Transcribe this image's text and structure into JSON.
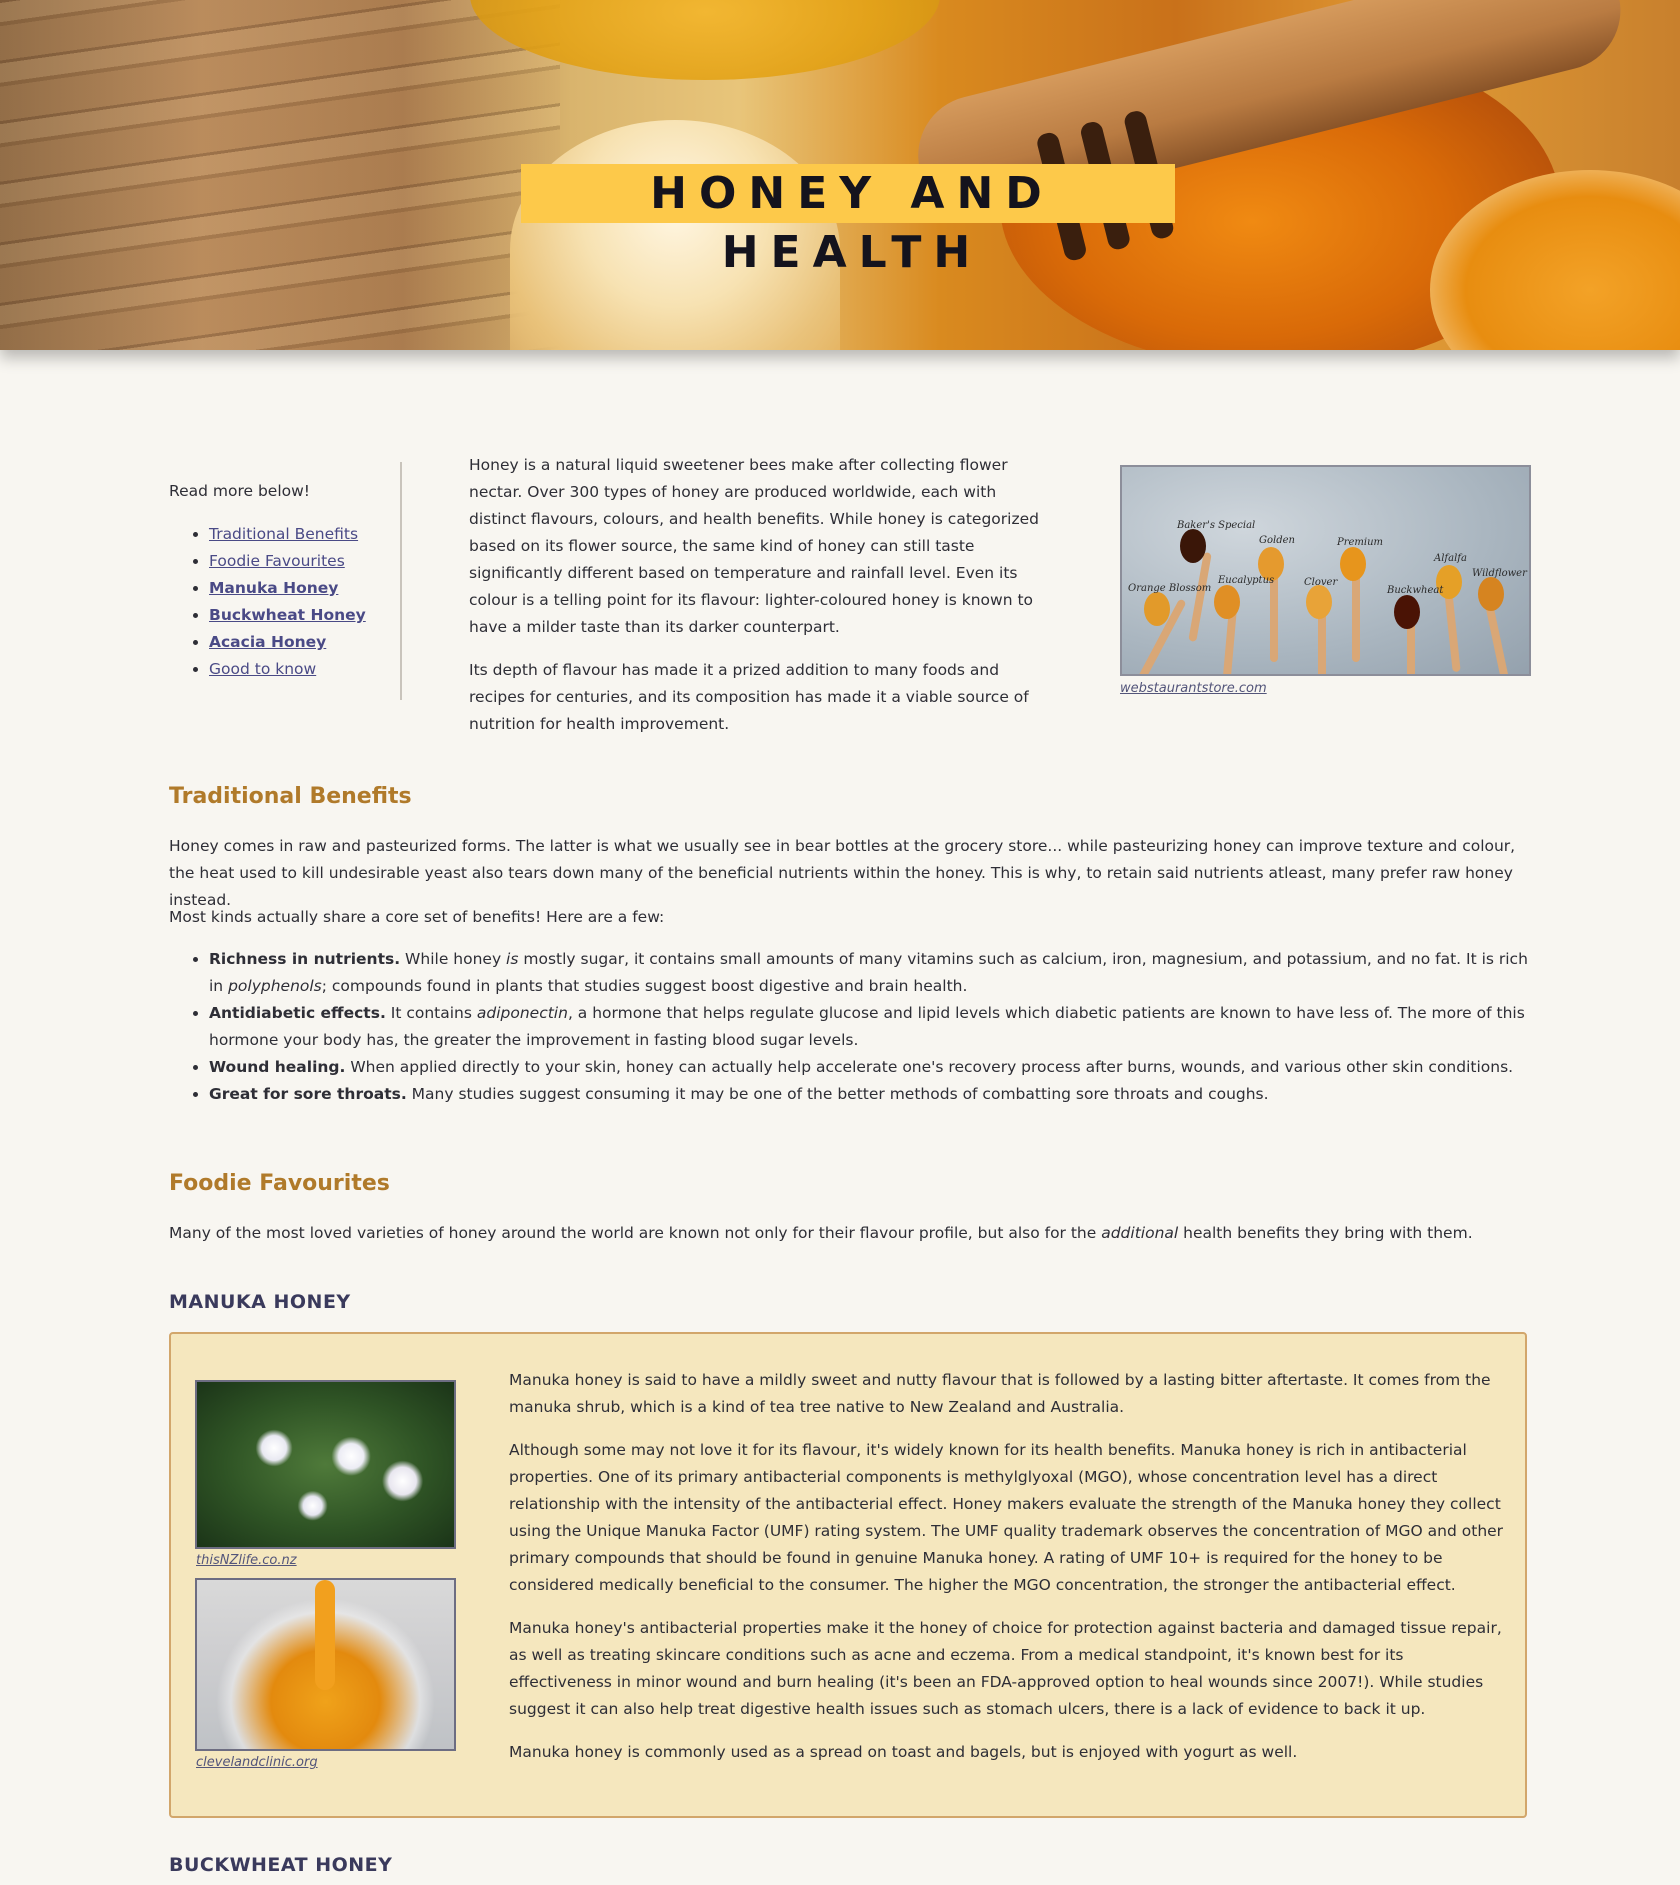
{
  "hero": {
    "title": "HONEY AND HEALTH"
  },
  "toc": {
    "lead": "Read more below!",
    "items": [
      {
        "label": "Traditional Benefits",
        "bold": false
      },
      {
        "label": "Foodie Favourites",
        "bold": false
      },
      {
        "label": "Manuka Honey",
        "bold": true
      },
      {
        "label": "Buckwheat Honey",
        "bold": true
      },
      {
        "label": "Acacia Honey",
        "bold": true
      },
      {
        "label": "Good to know",
        "bold": false
      }
    ]
  },
  "intro": {
    "p1": "Honey is a natural liquid sweetener bees make after collecting flower nectar. Over 300 types of honey are produced worldwide, each with distinct flavours, colours, and health benefits. While honey is categorized based on its flower source, the same kind of honey can still taste significantly different based on temperature and rainfall level. Even its colour is a telling point for its flavour: lighter-coloured honey is known to have a milder taste than its darker counterpart.",
    "p2": "Its depth of flavour has made it a prized addition to many foods and recipes for centuries, and its composition has made it a viable source of nutrition for health improvement.",
    "figure_credit": "webstaurantstore.com",
    "spoon_labels": [
      "Orange Blossom",
      "Baker's Special",
      "Eucalyptus",
      "Golden",
      "Clover",
      "Premium",
      "Buckwheat",
      "Alfalfa",
      "Wildflower"
    ]
  },
  "traditional": {
    "heading": "Traditional Benefits",
    "p1": "Honey comes in raw and pasteurized forms. The latter is what we usually see in bear bottles at the grocery store... while pasteurizing honey can improve texture and colour, the heat used to kill undesirable yeast also tears down many of the beneficial nutrients within the honey. This is why, to retain said nutrients atleast, many prefer raw honey instead.",
    "p2": "Most kinds actually share a core set of benefits! Here are a few:",
    "benefits": [
      {
        "title": "Richness in nutrients.",
        "pre": " While honey ",
        "em": "is",
        "mid": " mostly sugar, it contains small amounts of many vitamins such as calcium, iron, magnesium, and potassium, and no fat. It is rich in ",
        "em2": "polyphenols",
        "post": "; compounds found in plants that studies suggest boost digestive and brain health."
      },
      {
        "title": "Antidiabetic effects.",
        "pre": " It contains ",
        "em": "adiponectin",
        "mid": ", a hormone that helps regulate glucose and lipid levels which diabetic patients are known to have less of. The more of this hormone your body has, the greater the improvement in fasting blood sugar levels.",
        "em2": "",
        "post": ""
      },
      {
        "title": "Wound healing.",
        "pre": " When applied directly to your skin, honey can actually help accelerate one's recovery process after burns, wounds, and various other skin conditions.",
        "em": "",
        "mid": "",
        "em2": "",
        "post": ""
      },
      {
        "title": "Great for sore throats.",
        "pre": " Many studies suggest consuming it may be one of the better methods of combatting sore throats and coughs.",
        "em": "",
        "mid": "",
        "em2": "",
        "post": ""
      }
    ]
  },
  "foodie": {
    "heading": "Foodie Favourites",
    "p_pre": "Many of the most loved varieties of honey around the world are known not only for their flavour profile, but also for the ",
    "p_em": "additional",
    "p_post": " health benefits they bring with them."
  },
  "manuka": {
    "heading": "MANUKA HONEY",
    "credit1": "thisNZlife.co.nz",
    "credit2": "clevelandclinic.org",
    "p1": "Manuka honey is said to have a mildly sweet and nutty flavour that is followed by a lasting bitter aftertaste. It comes from the manuka shrub, which is a kind of tea tree native to New Zealand and Australia.",
    "p2": "Although some may not love it for its flavour, it's widely known for its health benefits. Manuka honey is rich in antibacterial properties. One of its primary antibacterial components is methylglyoxal (MGO), whose concentration level has a direct relationship with the intensity of the antibacterial effect. Honey makers evaluate the strength of the Manuka honey they collect using the Unique Manuka Factor (UMF) rating system. The UMF quality trademark observes the concentration of MGO and other primary compounds that should be found in genuine Manuka honey. A rating of UMF 10+ is required for the honey to be considered medically beneficial to the consumer. The higher the MGO concentration, the stronger the antibacterial effect.",
    "p3": "Manuka honey's antibacterial properties make it the honey of choice for protection against bacteria and damaged tissue repair, as well as treating skincare conditions such as acne and eczema. From a medical standpoint, it's known best for its effectiveness in minor wound and burn healing (it's been an FDA-approved option to heal wounds since 2007!). While studies suggest it can also help treat digestive health issues such as stomach ulcers, there is a lack of evidence to back it up.",
    "p4": "Manuka honey is commonly used as a spread on toast and bagels, but is enjoyed with yogurt as well."
  },
  "buckwheat": {
    "heading": "BUCKWHEAT HONEY"
  }
}
